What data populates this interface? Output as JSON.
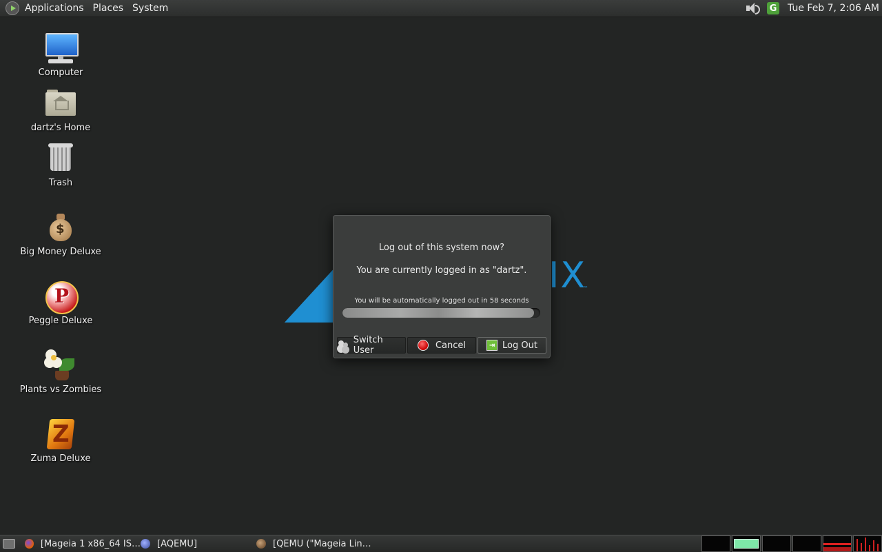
{
  "top_panel": {
    "menus": [
      "Applications",
      "Places",
      "System"
    ],
    "clock": "Tue Feb  7,  2:06 AM",
    "updater_letter": "G"
  },
  "desktop_icons": [
    {
      "label": "Computer",
      "icon": "computer-icon"
    },
    {
      "label": "dartz's Home",
      "icon": "home-folder-icon"
    },
    {
      "label": "Trash",
      "icon": "trash-icon"
    },
    {
      "label": "Big Money Deluxe",
      "icon": "money-bag-icon"
    },
    {
      "label": "Peggle Deluxe",
      "icon": "peggle-icon"
    },
    {
      "label": "Plants vs Zombies",
      "icon": "plants-icon"
    },
    {
      "label": "Zuma Deluxe",
      "icon": "zuma-icon"
    }
  ],
  "background_logo": {
    "text": "IX",
    "tm": "™",
    "color": "#1f8fd2"
  },
  "dialog": {
    "title": "Log out of this system now?",
    "subtitle": "You are currently logged in as \"dartz\".",
    "countdown": "You will be automatically logged out in 58 seconds",
    "progress_fraction": 0.97,
    "buttons": {
      "switch_user": "Switch User",
      "cancel": "Cancel",
      "log_out": "Log Out"
    }
  },
  "bottom_panel": {
    "tasks": [
      {
        "label": "[Mageia 1 x86_64 IS…",
        "icon": "firefox-icon"
      },
      {
        "label": "[AQEMU]",
        "icon": "qemu-icon"
      },
      {
        "label": "[QEMU (\"Mageia Lin…",
        "icon": "qemu-window-icon"
      }
    ]
  }
}
